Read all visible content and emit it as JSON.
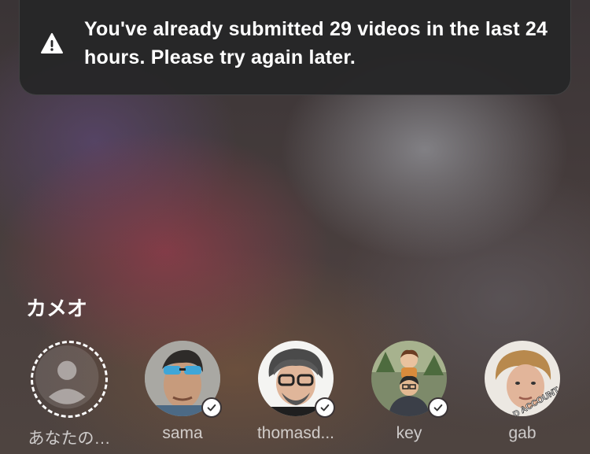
{
  "toast": {
    "icon": "warning-icon",
    "message": "You've already submitted 29 videos in the last 24 hours. Please try again later."
  },
  "cameos": {
    "title": "カメオ",
    "items": [
      {
        "label": "あなたの…",
        "icon": "person-placeholder-icon",
        "verified": false
      },
      {
        "label": "sama",
        "verified": true
      },
      {
        "label": "thomasd...",
        "verified": true
      },
      {
        "label": "key",
        "verified": true
      },
      {
        "label": "gab",
        "verified": false,
        "sticker_text": "OLD ACCOUNT"
      }
    ]
  }
}
